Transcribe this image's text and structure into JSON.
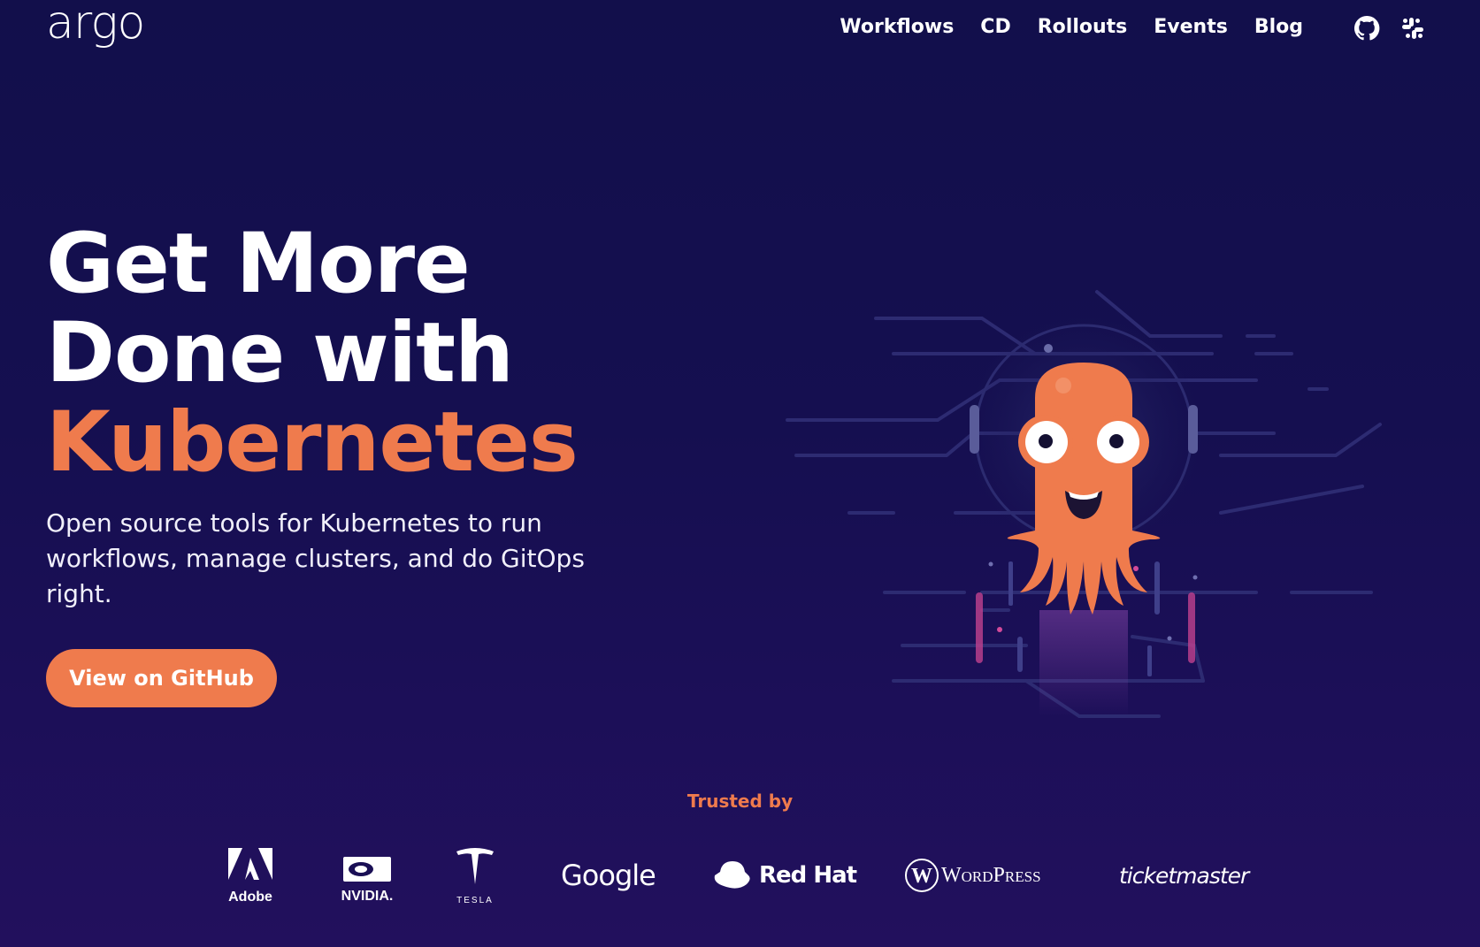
{
  "header": {
    "logo": "argo",
    "nav": [
      "Workflows",
      "CD",
      "Rollouts",
      "Events",
      "Blog"
    ],
    "icons": [
      "github-icon",
      "slack-icon"
    ]
  },
  "hero": {
    "title_line1": "Get More",
    "title_line2": "Done with",
    "title_accent": "Kubernetes",
    "subtitle": "Open source tools for Kubernetes to run workflows, manage clusters, and do GitOps right.",
    "cta": "View on GitHub"
  },
  "trusted": {
    "label": "Trusted by",
    "logos": [
      "Adobe",
      "NVIDIA.",
      "TESLA",
      "Google",
      "Red Hat",
      "WordPress",
      "ticketmaster"
    ]
  },
  "colors": {
    "background": "#120f4b",
    "accent": "#ef7b4d",
    "text": "#ffffff"
  }
}
